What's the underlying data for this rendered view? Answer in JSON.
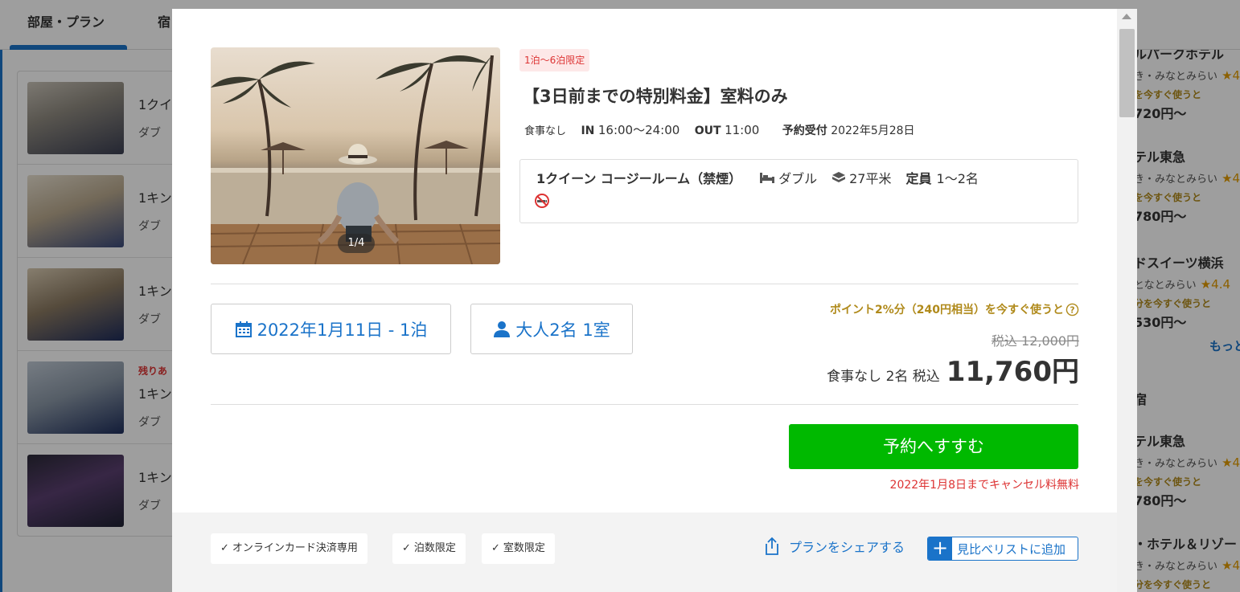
{
  "background": {
    "tabs": [
      {
        "label": "部屋・プラン"
      },
      {
        "label": "宿"
      }
    ],
    "room_list": [
      {
        "title": "1クイ",
        "sub": "ダブ",
        "remain": ""
      },
      {
        "title": "1キン",
        "sub": "ダブ",
        "remain": ""
      },
      {
        "title": "1キン",
        "sub": "ダブ",
        "remain": ""
      },
      {
        "title": "1キン",
        "sub": "ダブ",
        "remain": "残りあ"
      },
      {
        "title": "1キン",
        "sub": "ダブ",
        "remain": ""
      }
    ],
    "hotels": [
      {
        "name": "ルパークホテル",
        "area": "き・みなとみらい",
        "rating": "★4",
        "point": "を今すぐ使うと",
        "price": "720円〜"
      },
      {
        "name": "テル東急",
        "area": "き・みなとみらい",
        "rating": "★4",
        "point": "を今すぐ使うと",
        "price": "780円〜"
      },
      {
        "name": "ドスイーツ横浜",
        "area": "となとみらい",
        "rating": "★4.4",
        "point": "分を今すぐ使うと",
        "price": "530円〜"
      }
    ],
    "more_label": "もっと",
    "section_label": "宿",
    "hotels2": [
      {
        "name": "テル東急",
        "area": "き・みなとみらい",
        "rating": "★4",
        "point": "を今すぐ使うと",
        "price": "780円〜"
      },
      {
        "name": "・ホテル＆リゾー",
        "area": "き・みなとみらい",
        "rating": "★4",
        "point": "分を今すぐ使うと",
        "price": ""
      }
    ]
  },
  "modal": {
    "photo_counter": "1/4",
    "limit_badge": "1泊〜6泊限定",
    "plan_title": "【3日前までの特別料金】室料のみ",
    "meta": {
      "meal": "食事なし",
      "in_label": "IN",
      "in_value": "16:00〜24:00",
      "out_label": "OUT",
      "out_value": "11:00",
      "reserve_label": "予約受付",
      "reserve_value": "2022年5月28日"
    },
    "room": {
      "name": "1クイーン コージールーム（禁煙）",
      "bed": "ダブル",
      "size": "27平米",
      "capacity_label": "定員",
      "capacity_value": "1〜2名"
    },
    "date_selector": "2022年1月11日 - 1泊",
    "guest_selector": "大人2名 1室",
    "point_text": "ポイント2%分（240円相当）を今すぐ使うと",
    "old_price": "税込 12,000円",
    "price_prefix": "食事なし 2名 税込",
    "price": "11,760円",
    "reserve_button": "予約へすすむ",
    "cancel_note": "2022年1月8日までキャンセル料無料",
    "tags": [
      "オンラインカード決済専用",
      "泊数限定",
      "室数限定"
    ],
    "share_label": "プランをシェアする",
    "compare_label": "見比べリストに追加"
  },
  "colors": {
    "accent": "#1a73c9",
    "reserve": "#00b900",
    "alert": "#dd3333",
    "point": "#b08a1b"
  }
}
